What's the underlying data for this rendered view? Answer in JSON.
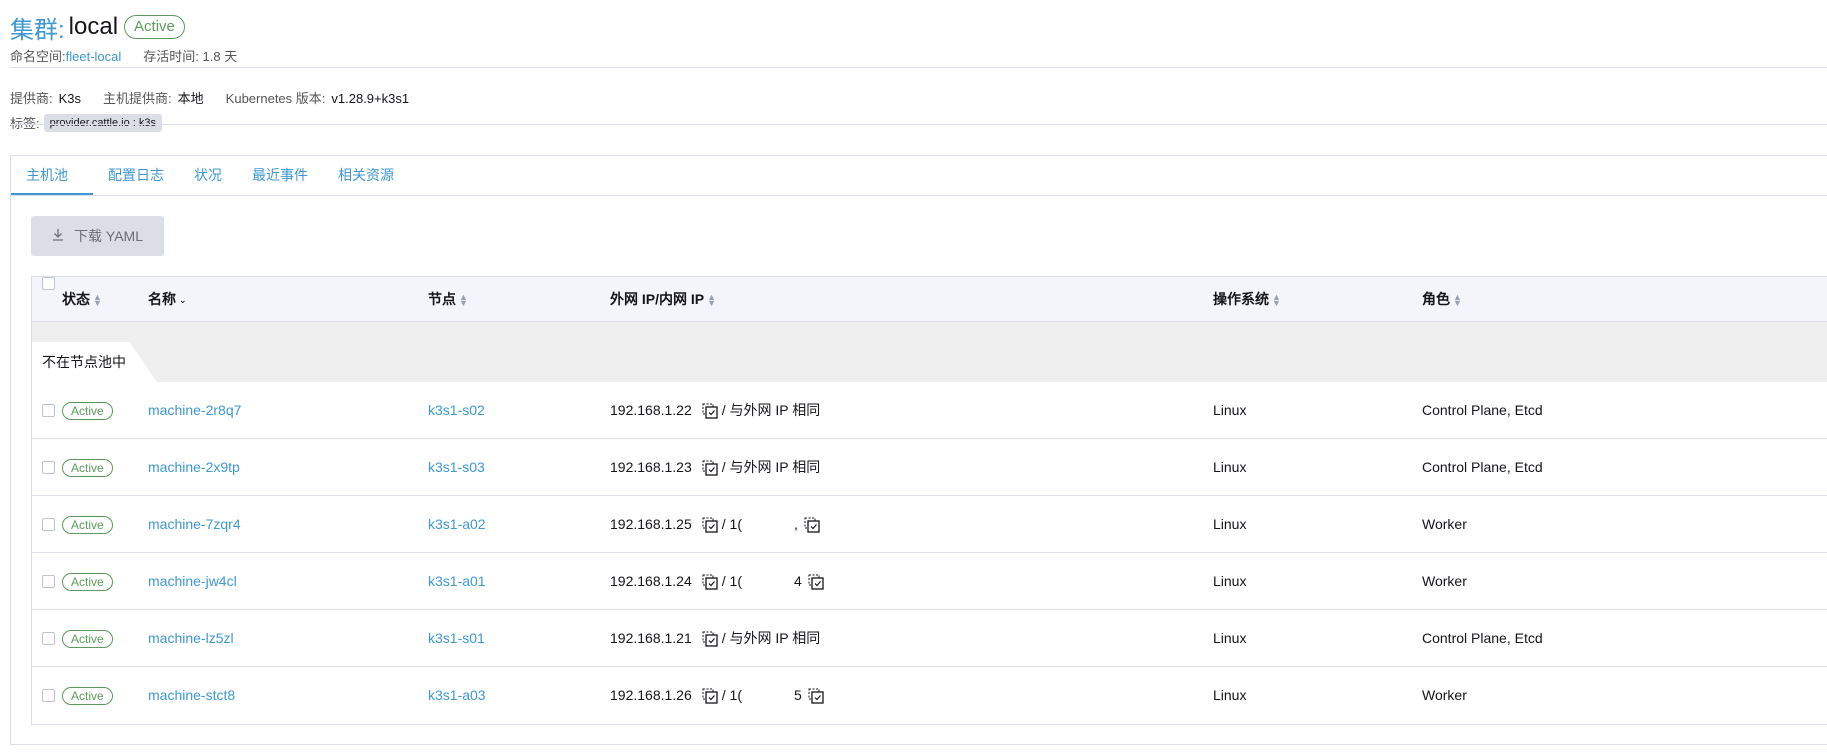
{
  "header": {
    "title_prefix": "集群:",
    "title_name": "local",
    "state": "Active",
    "namespace_label": "命名空间:",
    "namespace_value": "fleet-local",
    "age_label": "存活时间:",
    "age_value": "1.8 天"
  },
  "details": {
    "provider_label": "提供商:",
    "provider_value": "K3s",
    "host_provider_label": "主机提供商:",
    "host_provider_value": "本地",
    "k8s_version_label": "Kubernetes 版本:",
    "k8s_version_value": "v1.28.9+k3s1",
    "labels_label": "标签:",
    "label_chip": "provider.cattle.io : k3s"
  },
  "tabs": [
    {
      "label": "主机池",
      "active": true
    },
    {
      "label": "配置日志",
      "active": false
    },
    {
      "label": "状况",
      "active": false
    },
    {
      "label": "最近事件",
      "active": false
    },
    {
      "label": "相关资源",
      "active": false
    }
  ],
  "download_button": "下载 YAML",
  "table": {
    "columns": {
      "state": "状态",
      "name": "名称",
      "node": "节点",
      "ip": "外网 IP/内网 IP",
      "os": "操作系统",
      "roles": "角色"
    },
    "group_label": "不在节点池中",
    "rows": [
      {
        "state": "Active",
        "name": "machine-2r8q7",
        "node": "k3s1-s02",
        "ip": "192.168.1.22",
        "internal": "/ 与外网 IP 相同",
        "masked": false,
        "os": "Linux",
        "roles": "Control Plane, Etcd"
      },
      {
        "state": "Active",
        "name": "machine-2x9tp",
        "node": "k3s1-s03",
        "ip": "192.168.1.23",
        "internal": "/ 与外网 IP 相同",
        "masked": false,
        "os": "Linux",
        "roles": "Control Plane, Etcd"
      },
      {
        "state": "Active",
        "name": "machine-7zqr4",
        "node": "k3s1-a02",
        "ip": "192.168.1.25",
        "internal": "/ 1(",
        "internal_tail": ",",
        "masked": true,
        "os": "Linux",
        "roles": "Worker"
      },
      {
        "state": "Active",
        "name": "machine-jw4cl",
        "node": "k3s1-a01",
        "ip": "192.168.1.24",
        "internal": "/ 1(",
        "internal_tail": "4",
        "masked": true,
        "os": "Linux",
        "roles": "Worker"
      },
      {
        "state": "Active",
        "name": "machine-lz5zl",
        "node": "k3s1-s01",
        "ip": "192.168.1.21",
        "internal": "/ 与外网 IP 相同",
        "masked": false,
        "os": "Linux",
        "roles": "Control Plane, Etcd"
      },
      {
        "state": "Active",
        "name": "machine-stct8",
        "node": "k3s1-a03",
        "ip": "192.168.1.26",
        "internal": "/ 1(",
        "internal_tail": "5",
        "masked": true,
        "os": "Linux",
        "roles": "Worker"
      }
    ]
  },
  "colors": {
    "accent": "#3d98d3",
    "success": "#5d995d",
    "border": "#dcdee7"
  }
}
